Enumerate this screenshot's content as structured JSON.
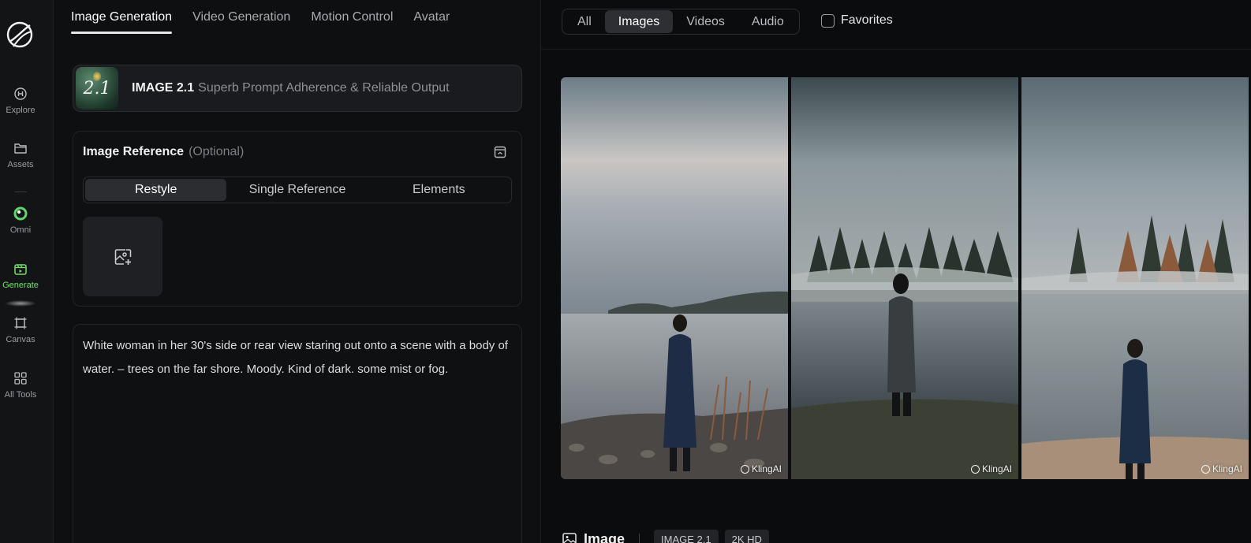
{
  "rail": {
    "items": [
      {
        "label": "Explore",
        "icon": "explore-icon"
      },
      {
        "label": "Assets",
        "icon": "folder-icon"
      },
      {
        "label": "Omni",
        "icon": "omni-icon"
      },
      {
        "label": "Generate",
        "icon": "generate-icon"
      },
      {
        "label": "Canvas",
        "icon": "canvas-icon"
      },
      {
        "label": "All Tools",
        "icon": "grid-icon"
      }
    ],
    "active": "Generate",
    "accent": "#6fe06a"
  },
  "gen_tabs": [
    "Image Generation",
    "Video Generation",
    "Motion Control",
    "Avatar"
  ],
  "gen_tab_active": "Image Generation",
  "model": {
    "thumb_text": "2.1",
    "name": "IMAGE 2.1",
    "description": "Superb Prompt Adherence & Reliable Output"
  },
  "image_reference": {
    "title": "Image Reference",
    "optional": "(Optional)",
    "modes": [
      "Restyle",
      "Single Reference",
      "Elements"
    ],
    "active_mode": "Restyle"
  },
  "prompt": {
    "text": "White woman in her 30's side or rear view staring out onto a scene with a body of water. – trees on the far shore. Moody. Kind of dark. some mist or fog."
  },
  "filters": {
    "tabs": [
      "All",
      "Images",
      "Videos",
      "Audio"
    ],
    "active": "Images",
    "favorites_label": "Favorites",
    "favorites_checked": false
  },
  "gallery": {
    "watermarks": [
      "KlingAI",
      "KlingAI",
      "KlingAI"
    ]
  },
  "result_info": {
    "title": "Image",
    "tags": [
      "IMAGE 2.1",
      "2K HD"
    ]
  }
}
